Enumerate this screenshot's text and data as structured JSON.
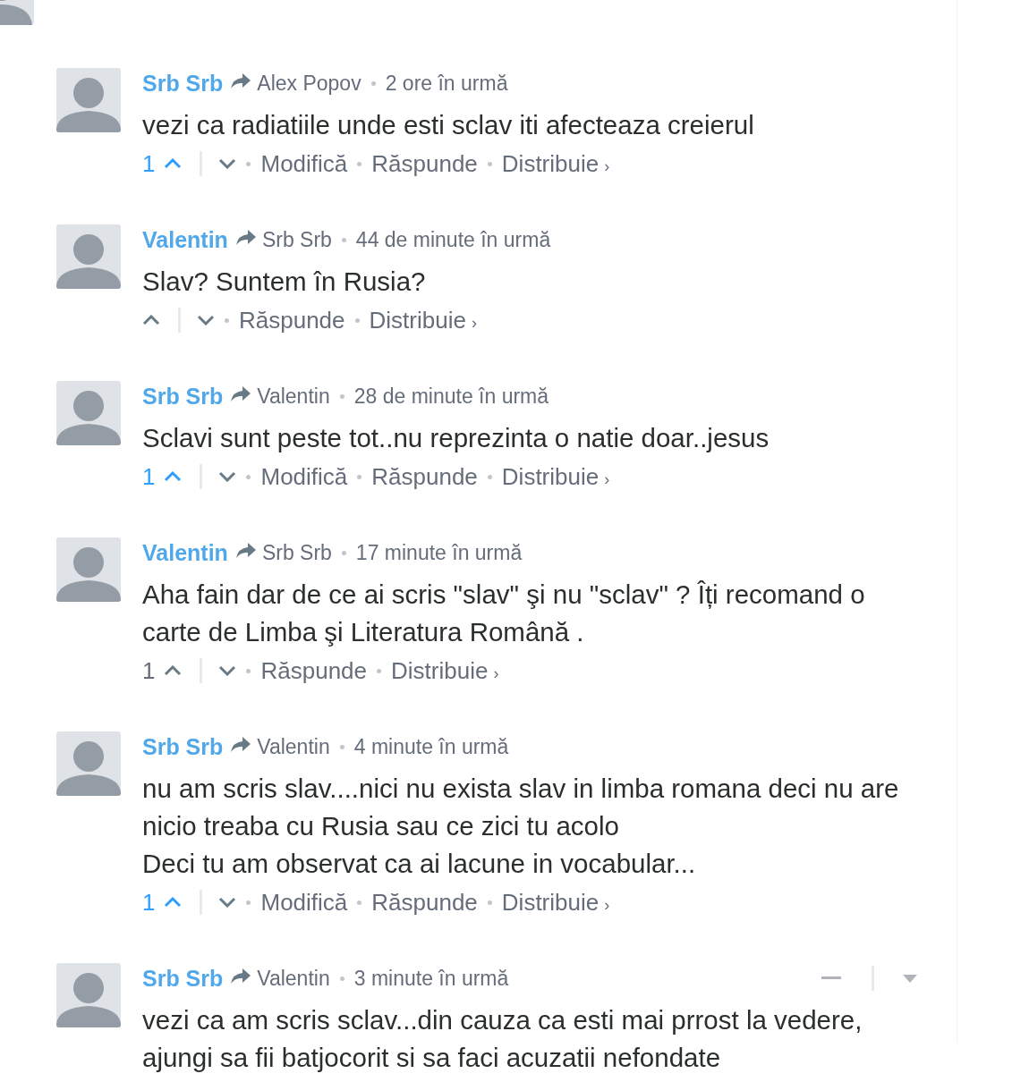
{
  "comments": [
    {
      "author": "Srb Srb",
      "reply_to": "Alex Popov",
      "time": "2 ore în urmă",
      "body": [
        "vezi ca radiatiile unde esti sclav iti afecteaza creierul"
      ],
      "votes": "1",
      "upvoted": true,
      "actions": [
        {
          "kind": "edit",
          "label": "Modifică"
        },
        {
          "kind": "reply",
          "label": "Răspunde"
        },
        {
          "kind": "share",
          "label": "Distribuie",
          "chevron": "›"
        }
      ]
    },
    {
      "author": "Valentin",
      "reply_to": "Srb Srb",
      "time": "44 de minute în urmă",
      "body": [
        "Slav? Suntem în Rusia?"
      ],
      "upvoted": false,
      "actions": [
        {
          "kind": "reply",
          "label": "Răspunde"
        },
        {
          "kind": "share",
          "label": "Distribuie",
          "chevron": "›"
        }
      ]
    },
    {
      "author": "Srb Srb",
      "reply_to": "Valentin",
      "time": "28 de minute în urmă",
      "body": [
        "Sclavi sunt peste tot..nu reprezinta o natie doar..jesus"
      ],
      "votes": "1",
      "upvoted": true,
      "actions": [
        {
          "kind": "edit",
          "label": "Modifică"
        },
        {
          "kind": "reply",
          "label": "Răspunde"
        },
        {
          "kind": "share",
          "label": "Distribuie",
          "chevron": "›"
        }
      ]
    },
    {
      "author": "Valentin",
      "reply_to": "Srb Srb",
      "time": "17 minute în urmă",
      "body": [
        "Aha fain dar de ce ai scris \"slav\" şi nu \"sclav\" ? Îți recomand o carte de Limba şi Literatura Română ."
      ],
      "votes": "1",
      "upvoted": false,
      "actions": [
        {
          "kind": "reply",
          "label": "Răspunde"
        },
        {
          "kind": "share",
          "label": "Distribuie",
          "chevron": "›"
        }
      ]
    },
    {
      "author": "Srb Srb",
      "reply_to": "Valentin",
      "time": "4 minute în urmă",
      "body": [
        "nu am scris slav....nici nu exista slav in limba romana deci nu are nicio treaba cu Rusia sau ce zici tu acolo",
        "Deci tu am observat ca ai lacune in vocabular..."
      ],
      "votes": "1",
      "upvoted": true,
      "actions": [
        {
          "kind": "edit",
          "label": "Modifică"
        },
        {
          "kind": "reply",
          "label": "Răspunde"
        },
        {
          "kind": "share",
          "label": "Distribuie",
          "chevron": "›"
        }
      ]
    },
    {
      "author": "Srb Srb",
      "reply_to": "Valentin",
      "time": "3 minute în urmă",
      "body": [
        "vezi ca am scris sclav...din cauza ca esti mai prrost la vedere, ajungi sa fii batjocorit si sa faci acuzatii nefondate"
      ],
      "controls_visible": true
    }
  ]
}
